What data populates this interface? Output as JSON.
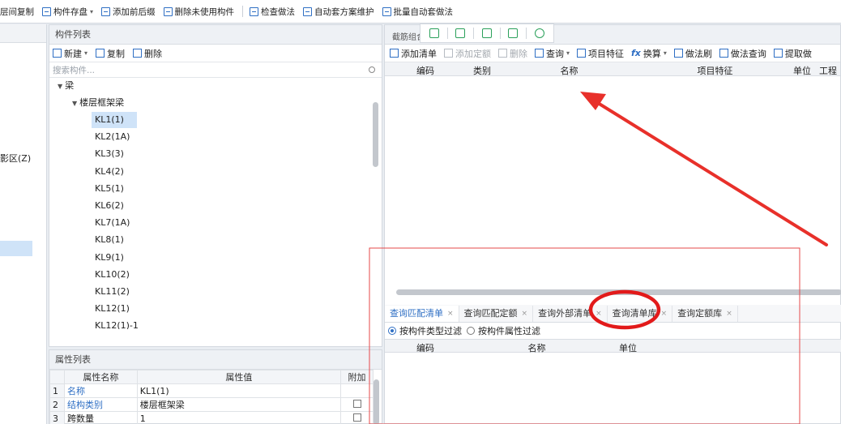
{
  "toolbar": {
    "items": [
      "层间复制",
      "构件存盘",
      "添加前后缀",
      "删除未使用构件",
      "检查做法",
      "自动套方案维护",
      "批量自动套做法"
    ]
  },
  "left_strip": {
    "label": "影区(Z)"
  },
  "component_list": {
    "title": "构件列表",
    "new_label": "新建",
    "copy_label": "复制",
    "delete_label": "删除",
    "search_placeholder": "搜索构件...",
    "root_label": "梁",
    "group_label": "楼层框架梁",
    "selected": "KL1(1)",
    "items": [
      "KL1(1)",
      "KL2(1A)",
      "KL3(3)",
      "KL4(2)",
      "KL5(1)",
      "KL6(2)",
      "KL7(1A)",
      "KL8(1)",
      "KL9(1)",
      "KL10(2)",
      "KL11(2)",
      "KL12(1)",
      "KL12(1)-1"
    ]
  },
  "property_list": {
    "title": "属性列表",
    "headers": [
      "属性名称",
      "属性值",
      "附加"
    ],
    "rows": [
      {
        "num": "1",
        "name": "名称",
        "value": "KL1(1)",
        "checkbox": false
      },
      {
        "num": "2",
        "name": "结构类别",
        "value": "楼层框架梁",
        "checkbox": true
      },
      {
        "num": "3",
        "name": "跨数量",
        "value": "1",
        "checkbox": true
      }
    ]
  },
  "right_panel": {
    "title": "截筋组合",
    "toolbar": {
      "add_list": "添加清单",
      "add_quota": "添加定额",
      "delete": "删除",
      "query": "查询",
      "item_feature": "项目特征",
      "convert": "换算",
      "method_brush": "做法刷",
      "method_query": "做法查询",
      "extract": "提取做"
    },
    "grid_headers": [
      "编码",
      "类别",
      "名称",
      "项目特征",
      "单位",
      "工程"
    ],
    "tabs": [
      "查询匹配清单",
      "查询匹配定额",
      "查询外部清单",
      "查询清单库",
      "查询定额库"
    ],
    "active_tab": "查询匹配清单",
    "filter_type": "按构件类型过滤",
    "filter_attr": "按构件属性过滤",
    "grid2_headers": [
      "编码",
      "名称",
      "单位"
    ]
  },
  "annotation_colors": {
    "arrow": "#e8302a",
    "circle": "#e21a1a",
    "frame": "#e6484a"
  }
}
